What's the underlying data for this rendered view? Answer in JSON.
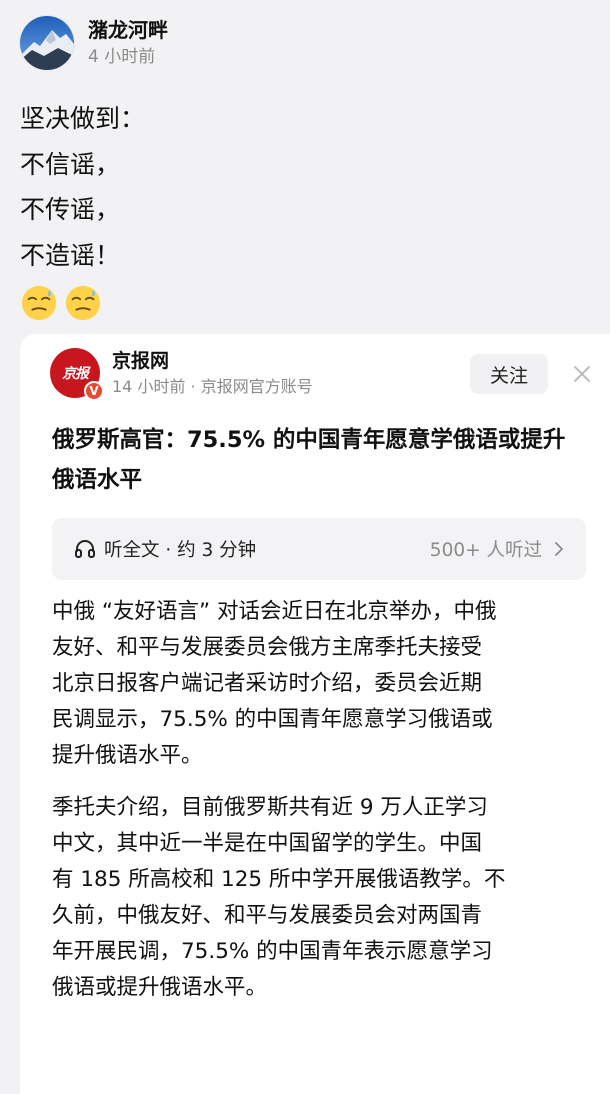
{
  "post": {
    "author_name": "潴龙河畔",
    "time": "4 小时前",
    "content_lines": [
      "坚决做到：",
      "不信谣，",
      "不传谣，",
      "不造谣！"
    ],
    "emojis": [
      "sweating-face-emoji",
      "sweating-face-emoji"
    ]
  },
  "shared_article": {
    "source_logo_text": "京报",
    "source_name": "京报网",
    "source_meta": "14 小时前 · 京报网官方账号",
    "verified_badge": "V",
    "follow_label": "关注",
    "title": "俄罗斯高官：75.5% 的中国青年愿意学俄语或提升俄语水平",
    "listen": {
      "label": "听全文 · 约 3 分钟",
      "count": "500+ 人听过"
    },
    "paragraphs": [
      [
        "中俄 “友好语言” 对话会近日在北京举办，中俄",
        "友好、和平与发展委员会俄方主席季托夫接受",
        "北京日报客户端记者采访时介绍，委员会近期",
        "民调显示，75.5% 的中国青年愿意学习俄语或",
        "提升俄语水平。"
      ],
      [
        "季托夫介绍，目前俄罗斯共有近 9 万人正学习",
        "中文，其中近一半是在中国留学的学生。中国",
        "有 185 所高校和 125 所中学开展俄语教学。不",
        "久前，中俄友好、和平与发展委员会对两国青",
        "年开展民调，75.5% 的中国青年表示愿意学习",
        "俄语或提升俄语水平。"
      ]
    ]
  },
  "colors": {
    "background": "#f2f2f4",
    "card": "#ffffff",
    "brand_red": "#c8161e",
    "muted_text": "#8b8b8b"
  }
}
